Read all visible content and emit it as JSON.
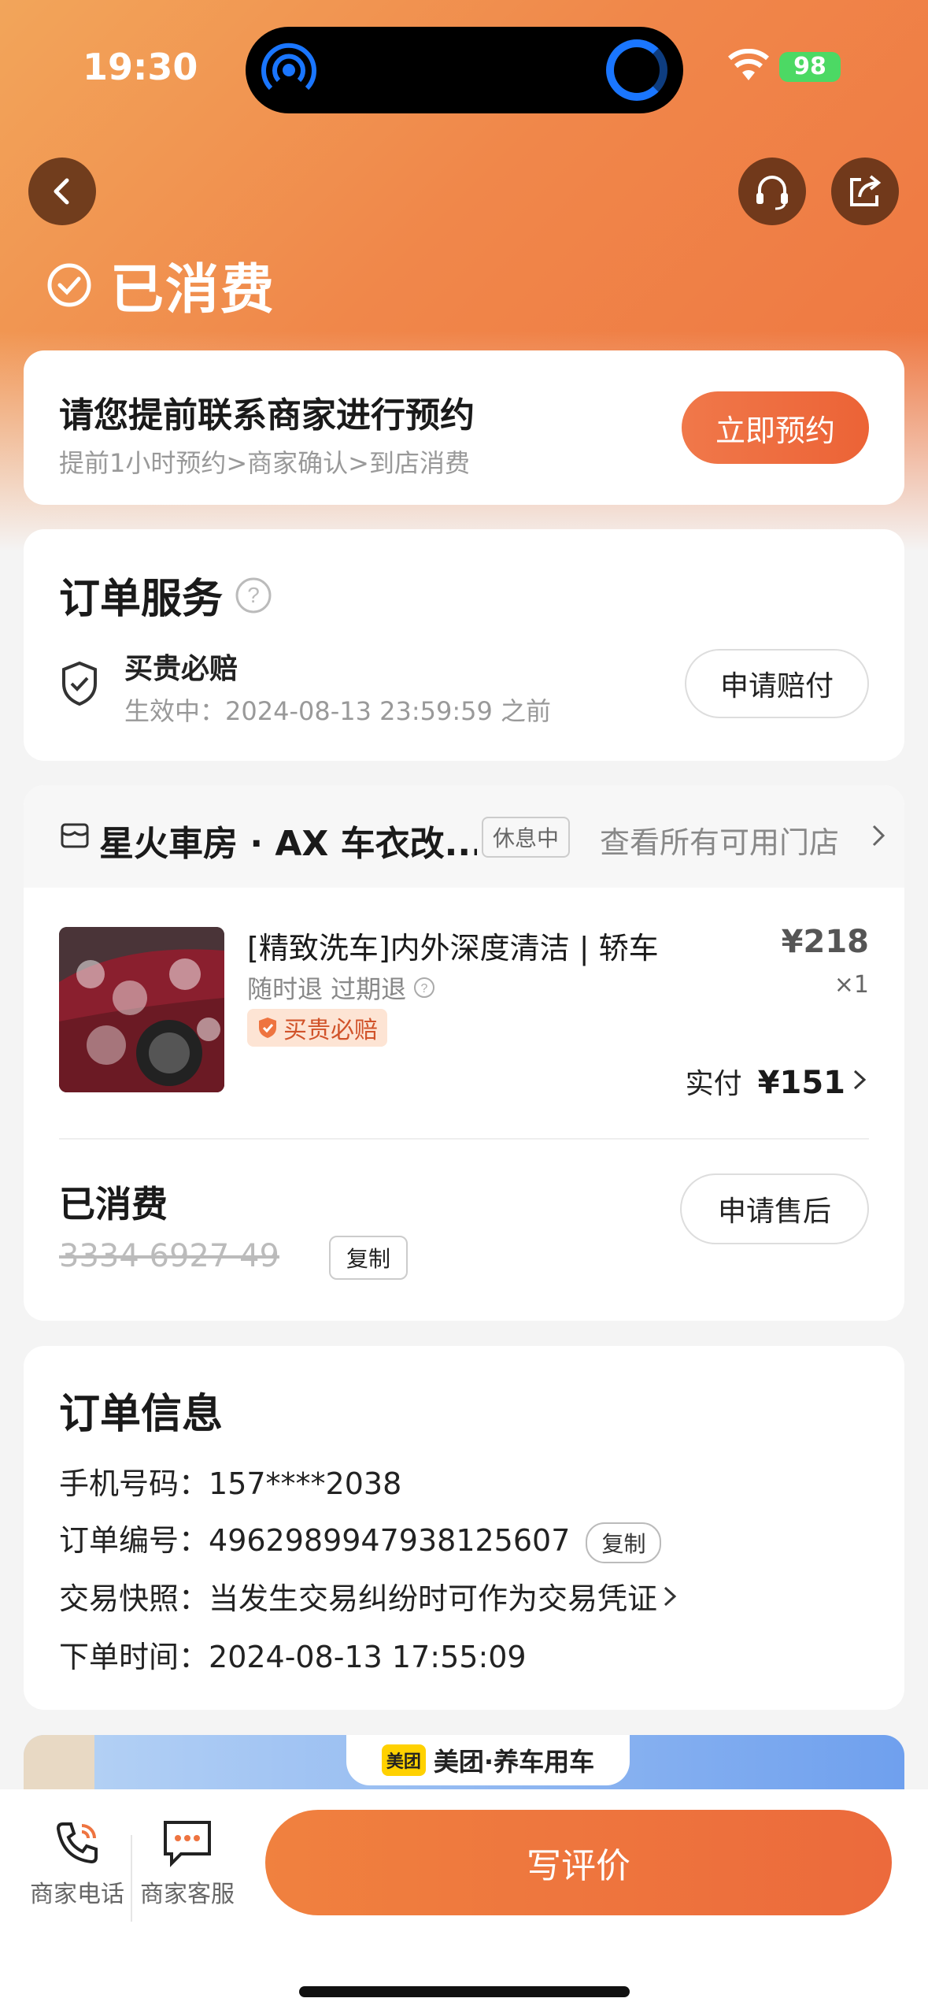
{
  "status_bar": {
    "time": "19:30",
    "battery": "98"
  },
  "header": {
    "status_title": "已消费"
  },
  "appointment": {
    "title": "请您提前联系商家进行预约",
    "subtitle": "提前1小时预约>商家确认>到店消费",
    "button": "立即预约"
  },
  "order_service": {
    "title": "订单服务",
    "guarantee_name": "买贵必赔",
    "guarantee_desc": "生效中：2024-08-13 23:59:59 之前",
    "button": "申请赔付"
  },
  "store": {
    "name": "星火車房 · AX 车衣改...",
    "status": "休息中",
    "all_stores_link": "查看所有可用门店"
  },
  "product": {
    "title": "[精致洗车]内外深度清洁 | 轿车",
    "refund_policy": "随时退  过期退",
    "badge": "买贵必赔",
    "price": "¥218",
    "quantity": "×1",
    "paid_label": "实付",
    "paid_amount": "¥151"
  },
  "voucher": {
    "status": "已消费",
    "code": "3334 6927 49",
    "copy": "复制",
    "after_sales_button": "申请售后"
  },
  "order_info": {
    "title": "订单信息",
    "phone_label": "手机号码：",
    "phone": "157****2038",
    "order_no_label": "订单编号：",
    "order_no": "4962989947938125607",
    "copy": "复制",
    "snapshot_label": "交易快照：",
    "snapshot": "当发生交易纠纷时可作为交易凭证",
    "time_label": "下单时间：",
    "time": "2024-08-13 17:55:09"
  },
  "banner": {
    "brand_logo": "美团",
    "text": "美团·养车用车"
  },
  "bottom": {
    "phone_label": "商家电话",
    "service_label": "商家客服",
    "review_button": "写评价"
  },
  "colors": {
    "accent": "#ee6a3a",
    "accent_light": "#f2a55a"
  },
  "icons": [
    "chevron-left-icon",
    "headset-icon",
    "share-icon",
    "check-circle-icon",
    "help-icon",
    "shield-check-icon",
    "store-icon",
    "chevron-right-icon",
    "phone-icon",
    "chat-icon"
  ]
}
